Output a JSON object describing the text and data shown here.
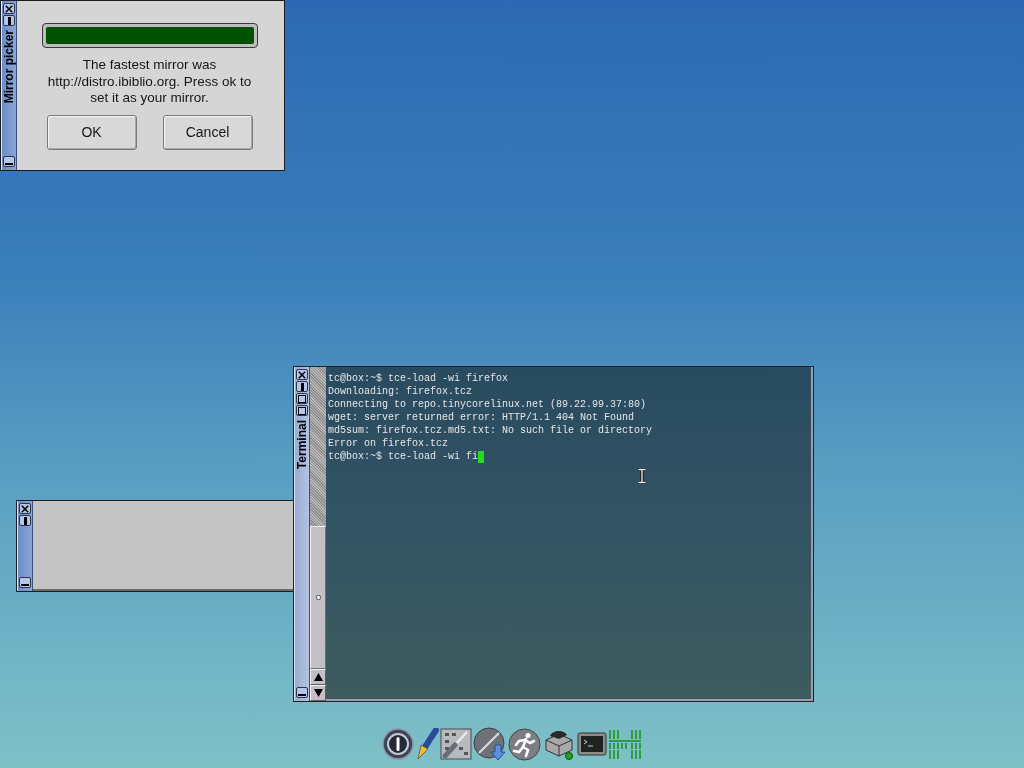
{
  "windows": [
    {
      "kind": "dialog",
      "title": "Mirror picker",
      "resizable": false,
      "progress": {
        "level": 1
      },
      "message": "The fastest mirror was http://distro.ibiblio.org. Press ok to set it as your mirror.",
      "buttons": [
        "OK",
        "Cancel"
      ]
    },
    {
      "kind": "blank",
      "resizable": false
    },
    {
      "kind": "terminal",
      "title": "Terminal",
      "resizable": true,
      "lines": [
        "tc@box:~$ tce-load -wi firefox",
        "Downloading: firefox.tcz",
        "Connecting to repo.tinycorelinux.net (89.22.99.37:80)",
        "wget: server returned error: HTTP/1.1 404 Not Found",
        "md5sum: firefox.tcz.md5.txt: No such file or directory",
        "Error on firefox.tcz",
        "tc@box:~$ tce-load -wi fi"
      ],
      "cursor": true
    }
  ]
}
